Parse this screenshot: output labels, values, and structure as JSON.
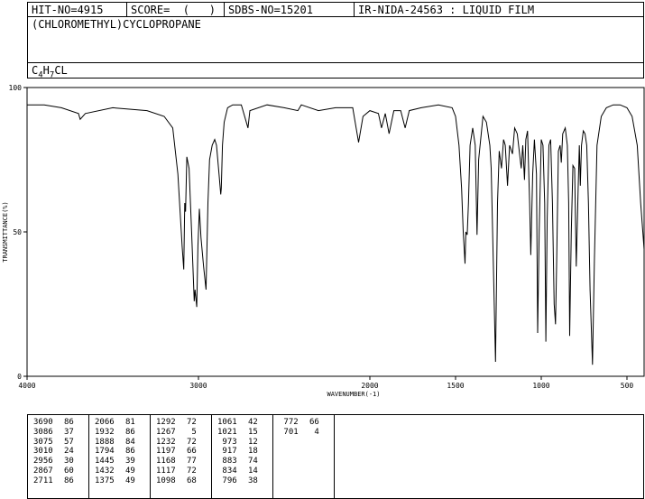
{
  "header": {
    "hit_no": "HIT-NO=4915",
    "score": "SCORE=  (   )",
    "sdbs_no": "SDBS-NO=15201",
    "ir_code": "IR-NIDA-24563 : LIQUID FILM"
  },
  "compound_name": "(CHLOROMETHYL)CYCLOPROPANE",
  "formula": {
    "c": "C",
    "c_n": "4",
    "h": "H",
    "h_n": "7",
    "rest": "CL"
  },
  "chart_data": {
    "type": "line",
    "xlabel": "WAVENUMBER(-1)",
    "ylabel": "TRANSMITTANCE(%)",
    "xlim": [
      4000,
      400
    ],
    "ylim": [
      0,
      100
    ],
    "x_ticks": [
      4000,
      3000,
      2000,
      1500,
      1000,
      500
    ],
    "y_ticks": [
      0,
      50,
      100
    ],
    "series": [
      {
        "points": [
          [
            4000,
            94
          ],
          [
            3900,
            94
          ],
          [
            3800,
            93
          ],
          [
            3700,
            91
          ],
          [
            3690,
            89
          ],
          [
            3660,
            91
          ],
          [
            3500,
            93
          ],
          [
            3300,
            92
          ],
          [
            3200,
            90
          ],
          [
            3150,
            86
          ],
          [
            3120,
            70
          ],
          [
            3095,
            45
          ],
          [
            3086,
            37
          ],
          [
            3080,
            60
          ],
          [
            3075,
            57
          ],
          [
            3068,
            76
          ],
          [
            3055,
            72
          ],
          [
            3040,
            50
          ],
          [
            3025,
            26
          ],
          [
            3020,
            30
          ],
          [
            3010,
            24
          ],
          [
            3003,
            45
          ],
          [
            2995,
            58
          ],
          [
            2985,
            48
          ],
          [
            2970,
            38
          ],
          [
            2956,
            30
          ],
          [
            2945,
            60
          ],
          [
            2935,
            75
          ],
          [
            2920,
            80
          ],
          [
            2905,
            82
          ],
          [
            2895,
            80
          ],
          [
            2880,
            70
          ],
          [
            2870,
            63
          ],
          [
            2867,
            65
          ],
          [
            2860,
            80
          ],
          [
            2850,
            88
          ],
          [
            2830,
            93
          ],
          [
            2800,
            94
          ],
          [
            2750,
            94
          ],
          [
            2711,
            86
          ],
          [
            2700,
            92
          ],
          [
            2600,
            94
          ],
          [
            2500,
            93
          ],
          [
            2420,
            92
          ],
          [
            2400,
            94
          ],
          [
            2300,
            92
          ],
          [
            2200,
            93
          ],
          [
            2100,
            93
          ],
          [
            2066,
            81
          ],
          [
            2040,
            90
          ],
          [
            2000,
            92
          ],
          [
            1950,
            91
          ],
          [
            1932,
            86
          ],
          [
            1910,
            91
          ],
          [
            1888,
            84
          ],
          [
            1860,
            92
          ],
          [
            1820,
            92
          ],
          [
            1794,
            86
          ],
          [
            1770,
            92
          ],
          [
            1700,
            93
          ],
          [
            1600,
            94
          ],
          [
            1520,
            93
          ],
          [
            1500,
            90
          ],
          [
            1480,
            80
          ],
          [
            1465,
            65
          ],
          [
            1455,
            50
          ],
          [
            1445,
            39
          ],
          [
            1440,
            50
          ],
          [
            1432,
            49
          ],
          [
            1425,
            60
          ],
          [
            1415,
            80
          ],
          [
            1400,
            86
          ],
          [
            1385,
            80
          ],
          [
            1375,
            49
          ],
          [
            1365,
            75
          ],
          [
            1340,
            90
          ],
          [
            1320,
            88
          ],
          [
            1300,
            80
          ],
          [
            1292,
            72
          ],
          [
            1280,
            40
          ],
          [
            1267,
            5
          ],
          [
            1255,
            60
          ],
          [
            1245,
            78
          ],
          [
            1232,
            72
          ],
          [
            1220,
            82
          ],
          [
            1210,
            80
          ],
          [
            1197,
            66
          ],
          [
            1185,
            80
          ],
          [
            1168,
            77
          ],
          [
            1155,
            86
          ],
          [
            1140,
            84
          ],
          [
            1117,
            72
          ],
          [
            1108,
            80
          ],
          [
            1098,
            68
          ],
          [
            1090,
            82
          ],
          [
            1080,
            85
          ],
          [
            1068,
            60
          ],
          [
            1061,
            42
          ],
          [
            1050,
            70
          ],
          [
            1040,
            82
          ],
          [
            1028,
            70
          ],
          [
            1021,
            15
          ],
          [
            1012,
            50
          ],
          [
            1000,
            82
          ],
          [
            990,
            80
          ],
          [
            980,
            60
          ],
          [
            973,
            12
          ],
          [
            965,
            55
          ],
          [
            955,
            80
          ],
          [
            945,
            82
          ],
          [
            935,
            60
          ],
          [
            925,
            25
          ],
          [
            917,
            18
          ],
          [
            910,
            40
          ],
          [
            900,
            78
          ],
          [
            890,
            80
          ],
          [
            883,
            74
          ],
          [
            875,
            84
          ],
          [
            860,
            86
          ],
          [
            848,
            80
          ],
          [
            840,
            60
          ],
          [
            834,
            14
          ],
          [
            825,
            50
          ],
          [
            815,
            73
          ],
          [
            805,
            72
          ],
          [
            796,
            38
          ],
          [
            785,
            65
          ],
          [
            778,
            80
          ],
          [
            772,
            66
          ],
          [
            765,
            80
          ],
          [
            755,
            85
          ],
          [
            745,
            84
          ],
          [
            735,
            80
          ],
          [
            725,
            60
          ],
          [
            715,
            30
          ],
          [
            701,
            4
          ],
          [
            690,
            40
          ],
          [
            675,
            80
          ],
          [
            650,
            90
          ],
          [
            620,
            93
          ],
          [
            580,
            94
          ],
          [
            540,
            94
          ],
          [
            500,
            93
          ],
          [
            470,
            90
          ],
          [
            440,
            80
          ],
          [
            420,
            60
          ],
          [
            400,
            44
          ]
        ]
      }
    ]
  },
  "peak_table": [
    {
      "wn": [
        "3690",
        "3086",
        "3075",
        "3010",
        "2956",
        "2867",
        "2711"
      ],
      "t": [
        "86",
        "37",
        "57",
        "24",
        "30",
        "60",
        "86"
      ]
    },
    {
      "wn": [
        "2066",
        "1932",
        "1888",
        "1794",
        "1445",
        "1432",
        "1375"
      ],
      "t": [
        "81",
        "86",
        "84",
        "86",
        "39",
        "49",
        "49"
      ]
    },
    {
      "wn": [
        "1292",
        "1267",
        "1232",
        "1197",
        "1168",
        "1117",
        "1098"
      ],
      "t": [
        "72",
        "5",
        "72",
        "66",
        "77",
        "72",
        "68"
      ]
    },
    {
      "wn": [
        "1061",
        "1021",
        "973",
        "917",
        "883",
        "834",
        "796"
      ],
      "t": [
        "42",
        "15",
        "12",
        "18",
        "74",
        "14",
        "38"
      ]
    },
    {
      "wn": [
        "772",
        "701"
      ],
      "t": [
        "66",
        "4"
      ]
    }
  ]
}
